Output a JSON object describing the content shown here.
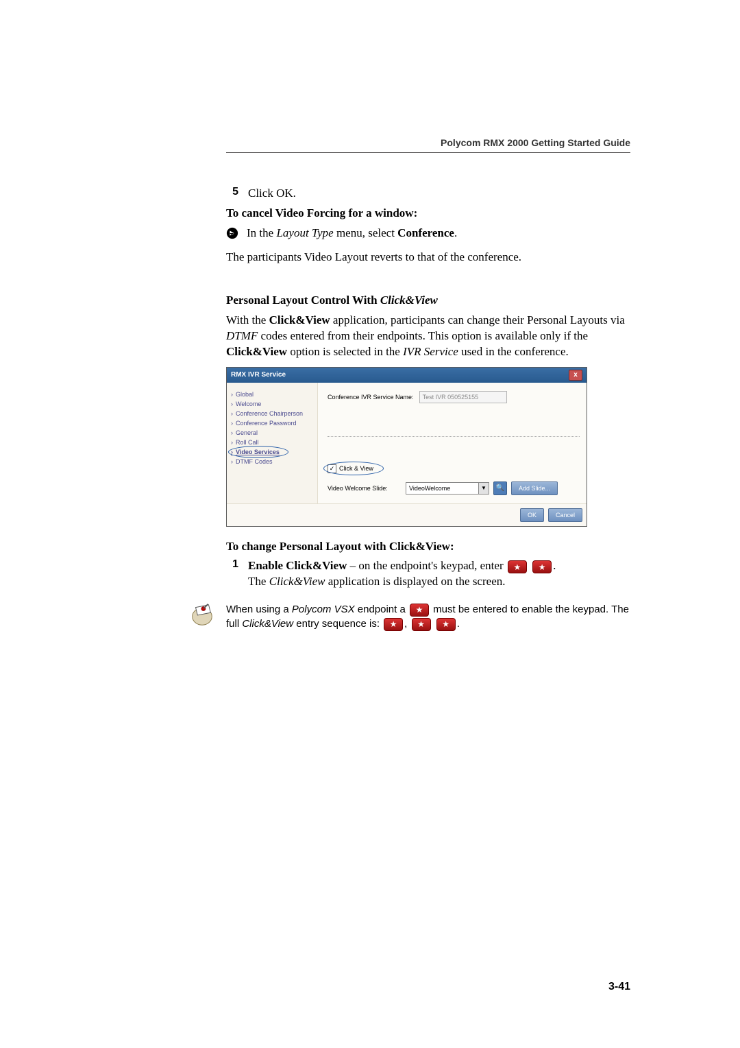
{
  "header": {
    "title": "Polycom RMX 2000 Getting Started Guide"
  },
  "step5": {
    "num": "5",
    "text": "Click OK."
  },
  "cancel": {
    "heading": "To cancel Video Forcing for a window:",
    "bullet_prefix": "In the ",
    "bullet_italic": "Layout Type",
    "bullet_mid": " menu, select ",
    "bullet_bold": "Conference",
    "bullet_suffix": ".",
    "after": "The participants Video Layout reverts to that of the conference."
  },
  "personal": {
    "heading_lead": "Personal Layout Control With ",
    "heading_italic": "Click&View",
    "p1_1": "With the ",
    "p1_2": "Click&View",
    "p1_3": " application, participants can change their ",
    "p1_4": "Personal Layouts",
    "p1_5": " via ",
    "p1_6": "DTMF",
    "p1_7": " codes entered from their endpoints. This option is available only if the ",
    "p1_8": "Click&View",
    "p1_9": " option is selected in the ",
    "p1_10": "IVR Service",
    "p1_11": " used in the conference."
  },
  "dialog": {
    "title": "RMX IVR Service",
    "close": "x",
    "sidebar": {
      "items": [
        "Global",
        "Welcome",
        "Conference Chairperson",
        "Conference Password",
        "General",
        "Roll Call",
        "Video Services",
        "DTMF Codes"
      ]
    },
    "main": {
      "svc_label": "Conference IVR Service Name:",
      "svc_value": "Test IVR 050525155",
      "chk_label": "Click & View",
      "slide_label": "Video Welcome Slide:",
      "slide_value": "VideoWelcome",
      "add_slide": "Add Slide...",
      "preview": "🔍"
    },
    "ok": "OK",
    "cancel": "Cancel"
  },
  "change": {
    "heading": "To change Personal Layout with Click&View:",
    "step1_num": "1",
    "step1_bold": "Enable Click&View",
    "step1_rest": " – on the endpoint's keypad, enter ",
    "step1_period": ".",
    "step1_after_1": "The ",
    "step1_after_2": "Click&View",
    "step1_after_3": " application is displayed on the screen."
  },
  "note": {
    "t1": "When using a ",
    "t2": "Polycom VSX",
    "t3": " endpoint a ",
    "t4": " must be entered to enable the keypad. The full ",
    "t5": "Click&View",
    "t6": " entry sequence is: ",
    "comma": ", ",
    "space": "  ",
    "period": "."
  },
  "key": {
    "star": "★"
  },
  "page_number": "3-41"
}
